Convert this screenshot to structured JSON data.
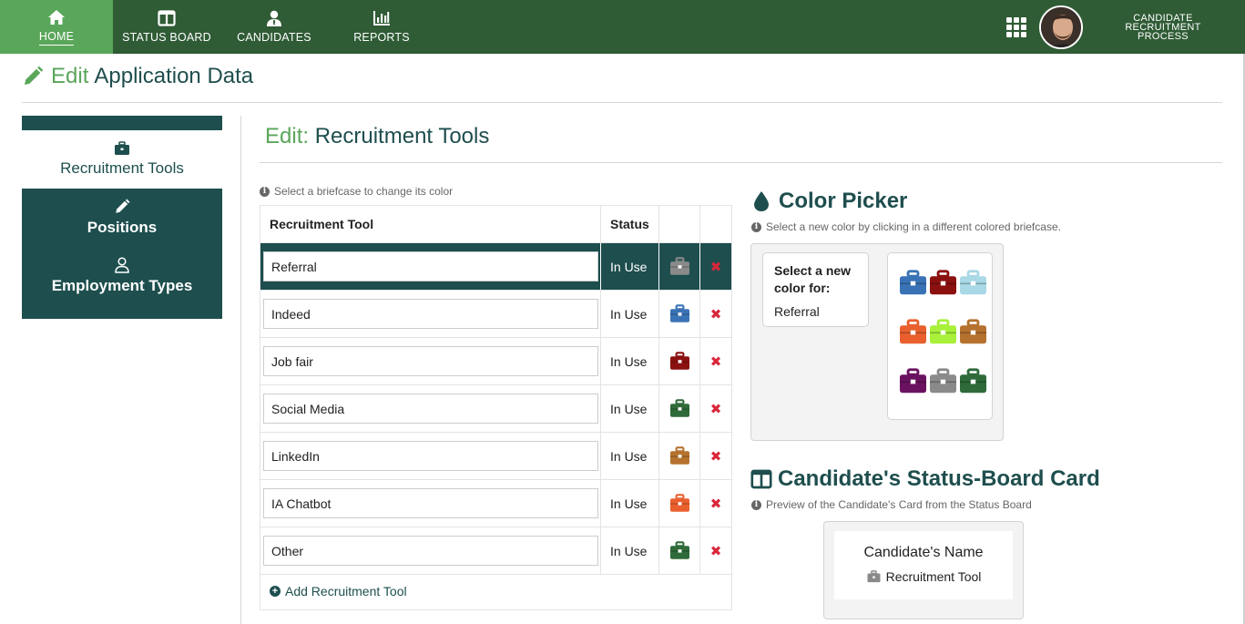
{
  "nav": {
    "items": [
      {
        "label": "HOME",
        "icon": "home-icon"
      },
      {
        "label": "STATUS BOARD",
        "icon": "columns-icon"
      },
      {
        "label": "CANDIDATES",
        "icon": "user-tie-icon"
      },
      {
        "label": "REPORTS",
        "icon": "bar-chart-icon"
      }
    ],
    "brand_line1": "CANDIDATE RECRUITMENT",
    "brand_line2": "PROCESS"
  },
  "page": {
    "title_accent": "Edit",
    "title_rest": "Application Data"
  },
  "sidebar": {
    "items": [
      {
        "label": "Recruitment Tools",
        "icon": "briefcase-icon"
      },
      {
        "label": "Positions",
        "icon": "pencil-icon"
      },
      {
        "label": "Employment Types",
        "icon": "user-icon"
      }
    ]
  },
  "section": {
    "title_accent": "Edit:",
    "title_rest": "Recruitment Tools",
    "hint": "Select a briefcase to change its color"
  },
  "table": {
    "headers": [
      "Recruitment Tool",
      "Status"
    ],
    "rows": [
      {
        "name": "Referral",
        "status": "In Use",
        "color": "#8a8a8a"
      },
      {
        "name": "Indeed",
        "status": "In Use",
        "color": "#3a73b5"
      },
      {
        "name": "Job fair",
        "status": "In Use",
        "color": "#8b1010"
      },
      {
        "name": "Social Media",
        "status": "In Use",
        "color": "#2f6a3a"
      },
      {
        "name": "LinkedIn",
        "status": "In Use",
        "color": "#b5722e"
      },
      {
        "name": "IA Chatbot",
        "status": "In Use",
        "color": "#e9602e"
      },
      {
        "name": "Other",
        "status": "In Use",
        "color": "#2f6a3a"
      }
    ],
    "delete_glyph": "✖",
    "add_label": "Add Recruitment Tool"
  },
  "color_picker": {
    "title": "Color Picker",
    "hint": "Select a new color by clicking in a different colored briefcase.",
    "select_label": "Select a new color for:",
    "selected_tool": "Referral",
    "swatches": [
      "#3a73b5",
      "#8b1010",
      "#a9d8e6",
      "#e9602e",
      "#a8f03a",
      "#b5722e",
      "#6a1260",
      "#8a8a8a",
      "#2f6a3a"
    ]
  },
  "status_board_card": {
    "title": "Candidate's Status-Board Card",
    "hint": "Preview of the Candidate's Card from the Status Board",
    "name": "Candidate's Name",
    "tool": "Recruitment Tool"
  },
  "colors": {
    "nav_bg": "#2f5b35",
    "nav_active": "#5aa65a",
    "primary": "#1e4e4e",
    "accent_green": "#5aa65a",
    "delete_red": "#d9263a"
  }
}
